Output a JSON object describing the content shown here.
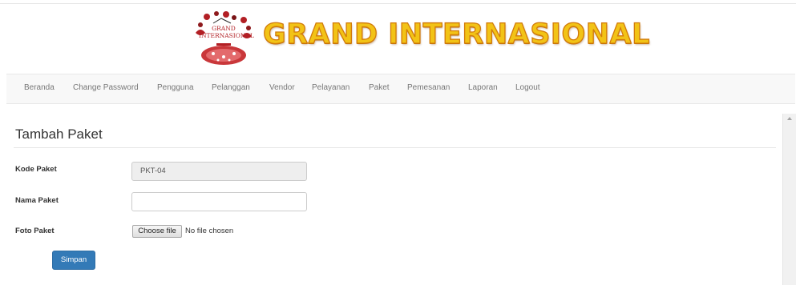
{
  "header": {
    "brand_text": "GRAND INTERNASIONAL",
    "logo_text": "GRAND INTERNASIONAL",
    "colors": {
      "brand_fill": "#f2c316",
      "brand_outline": "#d27b0a",
      "logo_red": "#b21f24"
    }
  },
  "nav": {
    "items": [
      {
        "label": "Beranda"
      },
      {
        "label": "Change Password"
      },
      {
        "label": "Pengguna"
      },
      {
        "label": "Pelanggan"
      },
      {
        "label": "Vendor"
      },
      {
        "label": "Pelayanan"
      },
      {
        "label": "Paket"
      },
      {
        "label": "Pemesanan"
      },
      {
        "label": "Laporan"
      },
      {
        "label": "Logout"
      }
    ]
  },
  "form": {
    "title": "Tambah Paket",
    "kode": {
      "label": "Kode Paket",
      "value": "PKT-04"
    },
    "nama": {
      "label": "Nama Paket",
      "value": ""
    },
    "foto": {
      "label": "Foto Paket",
      "button_label": "Choose file",
      "status": "No file chosen"
    },
    "submit_label": "Simpan",
    "colors": {
      "primary": "#337ab7"
    }
  }
}
